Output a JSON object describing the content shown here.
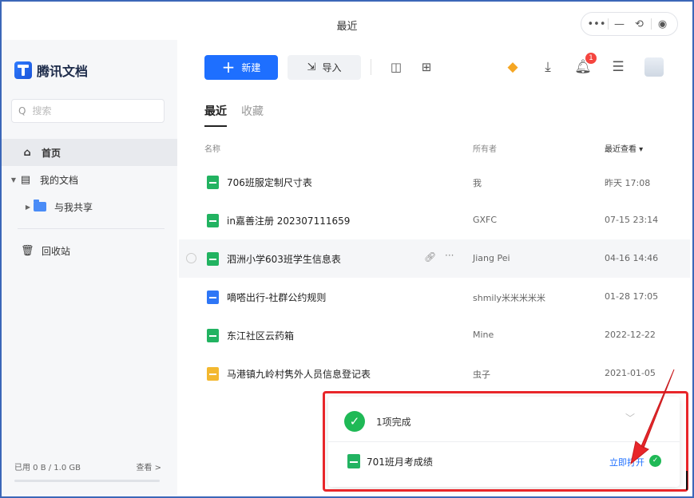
{
  "window": {
    "title": "最近"
  },
  "window_controls": [
    "•••",
    "—",
    "⟲",
    "◉"
  ],
  "sidebar": {
    "logo_text": "腾讯文档",
    "search_placeholder": "搜索",
    "items": [
      {
        "label": "首页",
        "active": true
      },
      {
        "label": "我的文档"
      },
      {
        "label": "与我共享"
      },
      {
        "label": "回收站"
      }
    ],
    "storage_label": "已用 0 B / 1.0 GB",
    "storage_link": "查看 >"
  },
  "toolbar": {
    "new_label": "新建",
    "import_label": "导入"
  },
  "header_tools": {
    "notification_count": "1"
  },
  "tabs": [
    {
      "label": "最近",
      "active": true
    },
    {
      "label": "收藏"
    }
  ],
  "columns": {
    "name": "名称",
    "owner": "所有者",
    "time": "最近查看 ▾"
  },
  "files": [
    {
      "name": "706班服定制尺寸表",
      "owner": "我",
      "time": "昨天 17:08",
      "type": "sheet"
    },
    {
      "name": "in嘉善注册 202307111659",
      "owner": "GXFC",
      "time": "07-15 23:14",
      "type": "sheet"
    },
    {
      "name": "泗洲小学603班学生信息表",
      "owner": "Jiang Pei",
      "time": "04-16 14:46",
      "type": "sheet"
    },
    {
      "name": "嘀嗒出行-社群公约规则",
      "owner": "shmily米米米米米",
      "time": "01-28 17:05",
      "type": "doc"
    },
    {
      "name": "东江社区云药箱",
      "owner": "Mine",
      "time": "2022-12-22",
      "type": "sheet"
    },
    {
      "name": "马港镇九岭村隽外人员信息登记表",
      "owner": "虫子",
      "time": "2021-01-05",
      "type": "form"
    }
  ],
  "upload_toast": {
    "title": "1项完成",
    "file_name": "701班月考成绩",
    "open_label": "立即打开"
  },
  "colors": {
    "accent": "#1e6fff",
    "success": "#1fb956",
    "highlight": "#e8262a"
  }
}
